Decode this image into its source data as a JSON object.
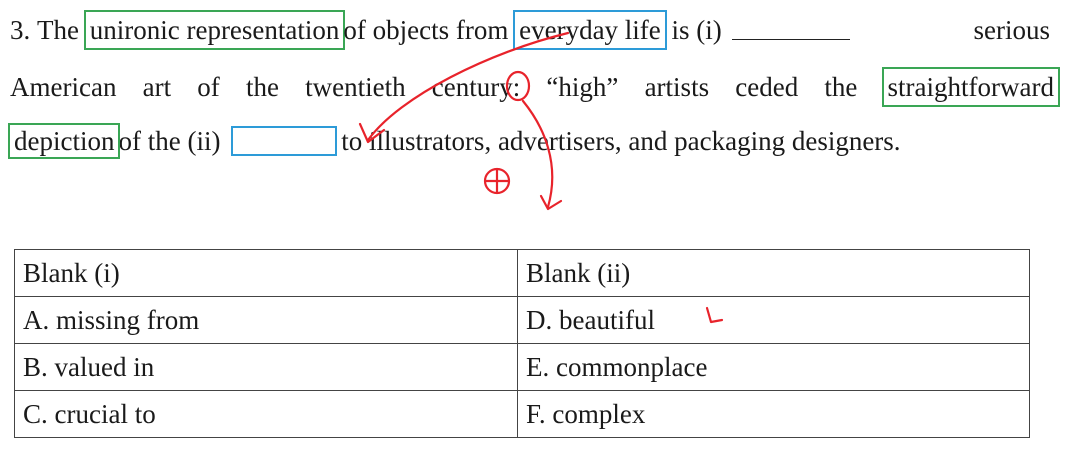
{
  "question": {
    "number": "3.",
    "line1": {
      "t1": "The",
      "h1": "unironic representation",
      "t2": "of objects from",
      "h2": "everyday life",
      "t3": "is (i)",
      "t4": "serious"
    },
    "line2": {
      "words": [
        "American",
        "art",
        "of",
        "the",
        "twentieth",
        "century:",
        "“high”",
        "artists",
        "ceded",
        "the"
      ],
      "h3": "straightforward"
    },
    "line3": {
      "h4": "depiction",
      "t1": "of the (ii)",
      "t2": "to illustrators, advertisers, and packaging designers."
    }
  },
  "table": {
    "headers": [
      "Blank (i)",
      "Blank (ii)"
    ],
    "rows": [
      [
        "A. missing from",
        "D. beautiful"
      ],
      [
        "B. valued in",
        "E. commonplace"
      ],
      [
        "C. crucial to",
        "F. complex"
      ]
    ]
  },
  "colors": {
    "highlight_green": "#3aa655",
    "highlight_blue": "#2d9bd8",
    "annotation_red": "#e8232b"
  }
}
